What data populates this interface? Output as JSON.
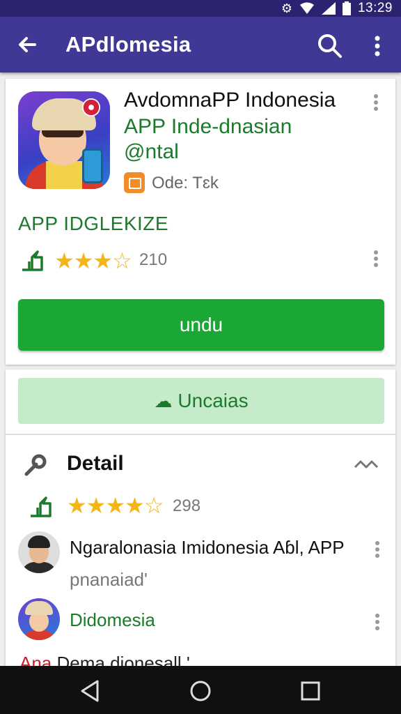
{
  "status_bar": {
    "time": "13:29"
  },
  "app_bar": {
    "title": "AРdlomesia"
  },
  "app_card": {
    "name": "AvdomnaPP Indonesia",
    "subtitle": "APP Inde-dnasian",
    "tag": "@ntal",
    "developer_label": "Ode: Tɛk",
    "section_heading": "APP IDGLEKIZE",
    "rating": {
      "stars_filled": 3,
      "stars_total": 4,
      "count": "210"
    },
    "install_label": "undu"
  },
  "details_card": {
    "secondary_button_label": "Uncaias",
    "detail_title": "Detail",
    "rating": {
      "stars_filled": 4,
      "stars_total": 5,
      "count": "298"
    },
    "list": [
      {
        "title": "Ngaralonasia Imidonesia  Aɓl, APP",
        "subtitle": "pnanaiad'"
      },
      {
        "title": "Didomesia"
      }
    ],
    "partial_item": {
      "prefix": "Ana",
      "text": "Dema dionesall '"
    }
  },
  "colors": {
    "status_bar": "#2b2370",
    "app_bar": "#3f3895",
    "accent_green": "#1aa736",
    "text_green": "#1b7a2c",
    "star": "#f3b51a",
    "nav_bar": "#101010"
  },
  "icons": [
    "settings-icon",
    "wifi-icon",
    "signal-icon",
    "battery-icon",
    "back-arrow-icon",
    "search-icon",
    "more-vert-icon",
    "app-icon",
    "developer-icon",
    "rank-up-icon",
    "star-icon",
    "cloud-icon",
    "link-icon",
    "expand-icon",
    "nav-back-icon",
    "nav-home-icon",
    "nav-recents-icon"
  ]
}
